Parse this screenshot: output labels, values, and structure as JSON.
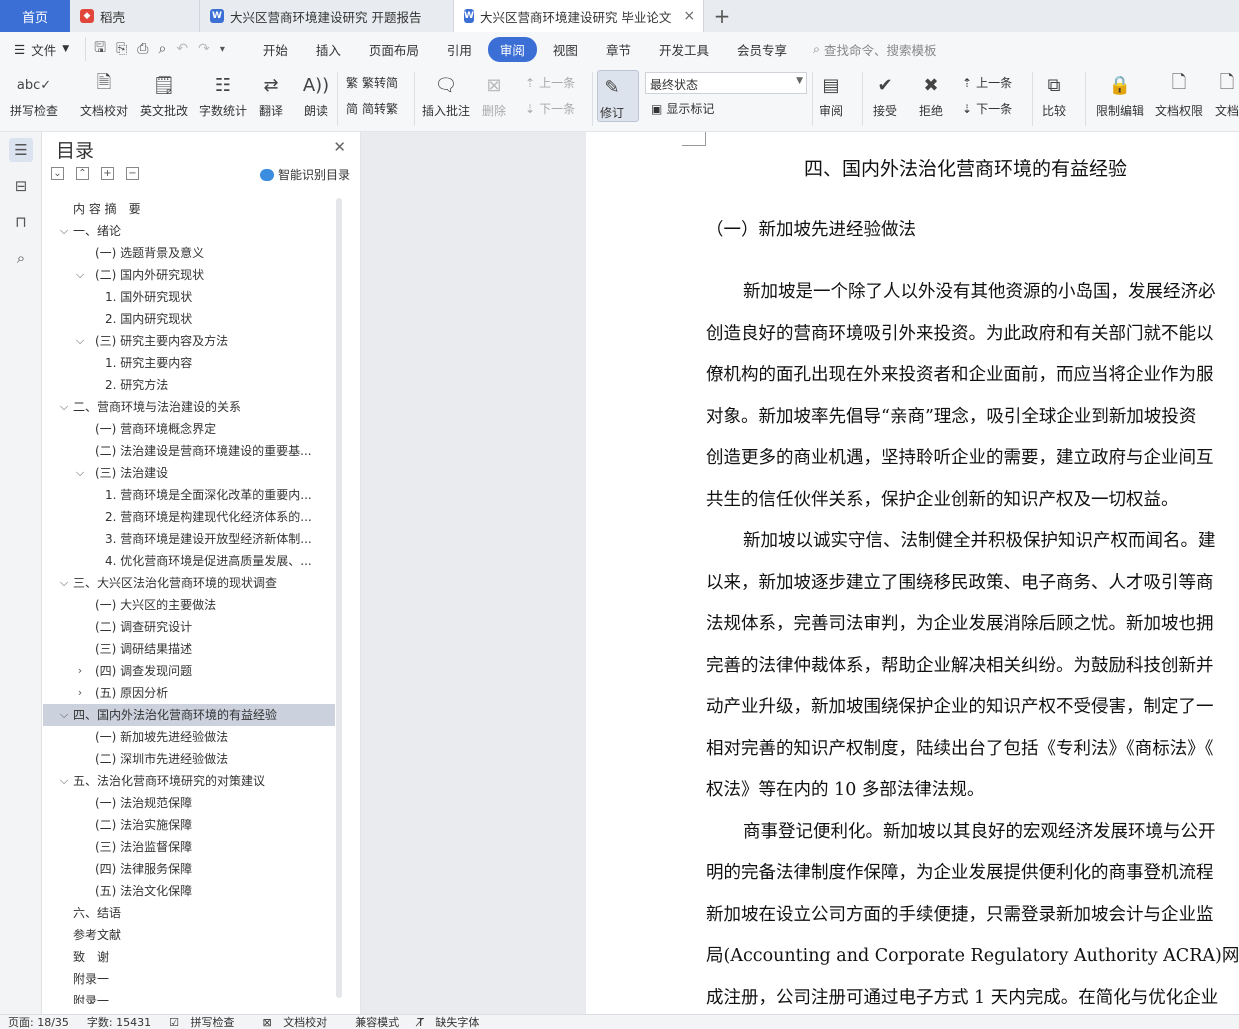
{
  "tabs": {
    "home": "首页",
    "items": [
      {
        "label": "稻壳",
        "icon": "docer-icon",
        "color": "#e0473a"
      },
      {
        "label": "大兴区营商环境建设研究 开题报告",
        "icon": "wps-writer-icon",
        "color": "#3b6fd6"
      },
      {
        "label": "大兴区营商环境建设研究 毕业论文",
        "icon": "wps-writer-icon",
        "color": "#3b6fd6"
      }
    ],
    "add": "+",
    "close": "×"
  },
  "menu": {
    "file": "文件",
    "tabs": [
      "开始",
      "插入",
      "页面布局",
      "引用",
      "审阅",
      "视图",
      "章节",
      "开发工具",
      "会员专享"
    ],
    "active_tab": "审阅",
    "search": "查找命令、搜索模板"
  },
  "ribbon": {
    "spell_check": "拼写检查",
    "doc_proof": "文档校对",
    "en_review": "英文批改",
    "word_count": "字数统计",
    "translate": "翻译",
    "read_aloud": "朗读",
    "trad_conv": "繁转简",
    "simp_conv": "简转繁",
    "insert_comment": "插入批注",
    "delete": "删除",
    "prev": "上一条",
    "next": "下一条",
    "track": "修订",
    "final_state": "最终状态",
    "show_marks": "显示标记",
    "review": "审阅",
    "accept": "接受",
    "reject": "拒绝",
    "prev2": "上一条",
    "next2": "下一条",
    "compare": "比较",
    "restrict_edit": "限制编辑",
    "doc_rights": "文档权限",
    "doc_more": "文档"
  },
  "toc": {
    "title": "目录",
    "smart": "智能识别目录",
    "items": [
      {
        "label": "内 容 摘　要",
        "level": 0,
        "chev": ""
      },
      {
        "label": "一、绪论",
        "level": 0,
        "chev": "v"
      },
      {
        "label": "(一) 选题背景及意义",
        "level": 1,
        "chev": ""
      },
      {
        "label": "(二) 国内外研究现状",
        "level": 1,
        "chev": "v"
      },
      {
        "label": "1. 国外研究现状",
        "level": 2,
        "chev": ""
      },
      {
        "label": "2. 国内研究现状",
        "level": 2,
        "chev": ""
      },
      {
        "label": "(三) 研究主要内容及方法",
        "level": 1,
        "chev": "v"
      },
      {
        "label": "1. 研究主要内容",
        "level": 2,
        "chev": ""
      },
      {
        "label": "2. 研究方法",
        "level": 2,
        "chev": ""
      },
      {
        "label": "二、营商环境与法治建设的关系",
        "level": 0,
        "chev": "v"
      },
      {
        "label": "(一) 营商环境概念界定",
        "level": 1,
        "chev": ""
      },
      {
        "label": "(二) 法治建设是营商环境建设的重要基...",
        "level": 1,
        "chev": ""
      },
      {
        "label": "(三) 法治建设",
        "level": 1,
        "chev": "v"
      },
      {
        "label": "1. 营商环境是全面深化改革的重要内...",
        "level": 2,
        "chev": ""
      },
      {
        "label": "2. 营商环境是构建现代化经济体系的...",
        "level": 2,
        "chev": ""
      },
      {
        "label": "3. 营商环境是建设开放型经济新体制...",
        "level": 2,
        "chev": ""
      },
      {
        "label": "4. 优化营商环境是促进高质量发展、...",
        "level": 2,
        "chev": ""
      },
      {
        "label": "三、大兴区法治化营商环境的现状调查",
        "level": 0,
        "chev": "v"
      },
      {
        "label": "(一) 大兴区的主要做法",
        "level": 1,
        "chev": ""
      },
      {
        "label": "(二) 调查研究设计",
        "level": 1,
        "chev": ""
      },
      {
        "label": "(三) 调研结果描述",
        "level": 1,
        "chev": ""
      },
      {
        "label": "(四) 调查发现问题",
        "level": 1,
        "chev": ">"
      },
      {
        "label": "(五) 原因分析",
        "level": 1,
        "chev": ">"
      },
      {
        "label": "四、国内外法治化营商环境的有益经验",
        "level": 0,
        "chev": "v",
        "highlight": true
      },
      {
        "label": "(一) 新加坡先进经验做法",
        "level": 1,
        "chev": ""
      },
      {
        "label": "(二) 深圳市先进经验做法",
        "level": 1,
        "chev": ""
      },
      {
        "label": "五、法治化营商环境研究的对策建议",
        "level": 0,
        "chev": "v"
      },
      {
        "label": "(一) 法治规范保障",
        "level": 1,
        "chev": ""
      },
      {
        "label": "(二) 法治实施保障",
        "level": 1,
        "chev": ""
      },
      {
        "label": "(三) 法治监督保障",
        "level": 1,
        "chev": ""
      },
      {
        "label": "(四) 法律服务保障",
        "level": 1,
        "chev": ""
      },
      {
        "label": "(五) 法治文化保障",
        "level": 1,
        "chev": ""
      },
      {
        "label": "六、结语",
        "level": 0,
        "chev": ""
      },
      {
        "label": "参考文献",
        "level": 0,
        "chev": ""
      },
      {
        "label": "致　谢",
        "level": 0,
        "chev": ""
      },
      {
        "label": "附录一",
        "level": 0,
        "chev": ""
      },
      {
        "label": "附录一",
        "level": 0,
        "chev": ""
      }
    ]
  },
  "doc": {
    "heading": "四、国内外法治化营商环境的有益经验",
    "subheading": "（一）新加坡先进经验做法",
    "lines": [
      {
        "text": "新加坡是一个除了人以外没有其他资源的小岛国，发展经济必",
        "indent": true
      },
      {
        "text": "创造良好的营商环境吸引外来投资。为此政府和有关部门就不能以",
        "indent": false
      },
      {
        "text": "僚机构的面孔出现在外来投资者和企业面前，而应当将企业作为服",
        "indent": false
      },
      {
        "text": "对象。新加坡率先倡导“亲商”理念，吸引全球企业到新加坡投资",
        "indent": false
      },
      {
        "text": "创造更多的商业机遇，坚持聆听企业的需要，建立政府与企业间互",
        "indent": false
      },
      {
        "text": "共生的信任伙伴关系，保护企业创新的知识产权及一切权益。",
        "indent": false
      },
      {
        "text": "新加坡以诚实守信、法制健全并积极保护知识产权而闻名。建",
        "indent": true
      },
      {
        "text": "以来，新加坡逐步建立了围绕移民政策、电子商务、人才吸引等商",
        "indent": false
      },
      {
        "text": "法规体系，完善司法审判，为企业发展消除后顾之忧。新加坡也拥",
        "indent": false
      },
      {
        "text": "完善的法律仲裁体系，帮助企业解决相关纠纷。为鼓励科技创新并",
        "indent": false
      },
      {
        "text": "动产业升级，新加坡围绕保护企业的知识产权不受侵害，制定了一",
        "indent": false
      },
      {
        "text": "相对完善的知识产权制度，陆续出台了包括《专利法》《商标法》《",
        "indent": false
      },
      {
        "text": "权法》等在内的 10 多部法律法规。",
        "indent": false
      },
      {
        "text": "商事登记便利化。新加坡以其良好的宏观经济发展环境与公开",
        "indent": true
      },
      {
        "text": "明的完备法律制度作保障，为企业发展提供便利化的商事登机流程",
        "indent": false
      },
      {
        "text": "新加坡在设立公司方面的手续便捷，只需登录新加坡会计与企业监",
        "indent": false
      },
      {
        "text": "局(Accounting and Corporate Regulatory Authority ACRA)网站即可",
        "indent": false
      },
      {
        "text": "成注册，公司注册可通过电子方式 1 天内完成。在简化与优化企业",
        "indent": false
      }
    ]
  },
  "status": {
    "page": "页面: 18/35",
    "words": "字数: 15431",
    "spell": "拼写检查",
    "proof": "文档校对",
    "compat": "兼容模式",
    "missing_font": "缺失字体"
  }
}
